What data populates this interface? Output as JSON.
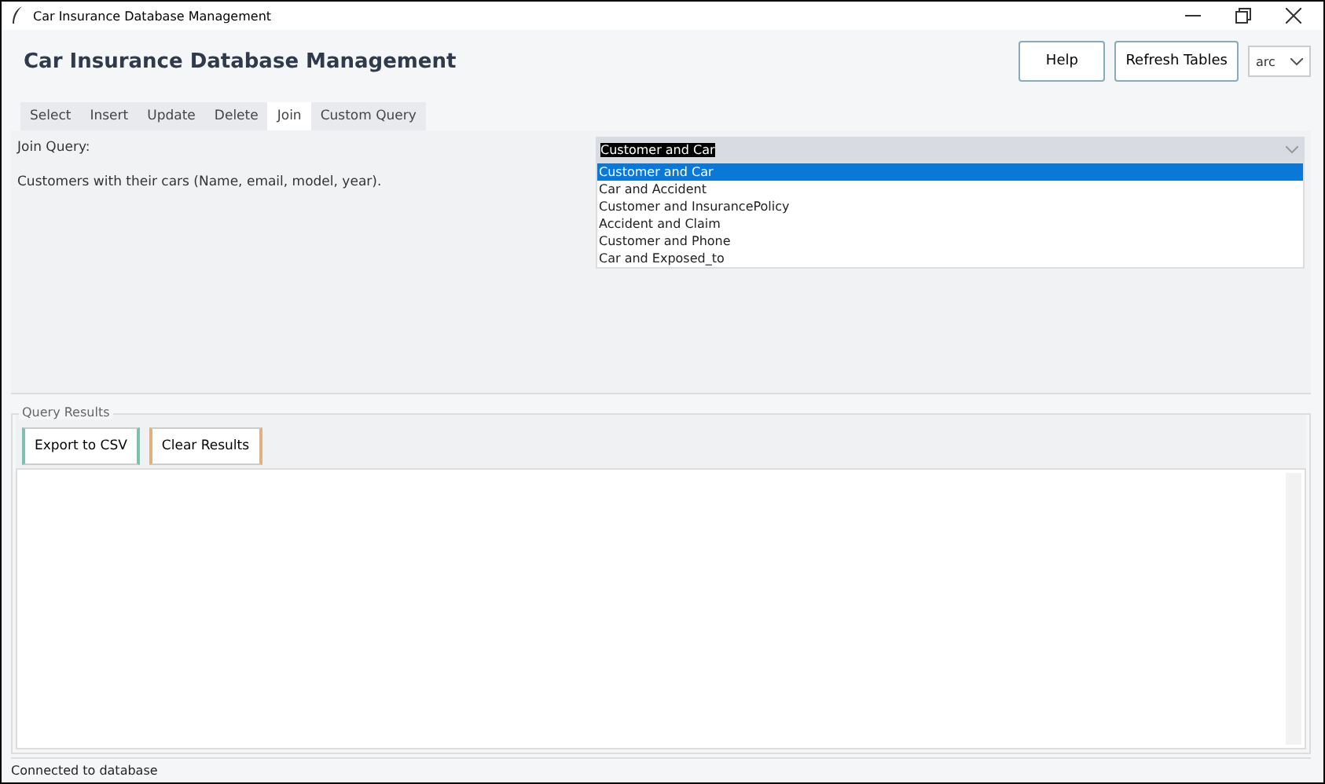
{
  "window": {
    "title": "Car Insurance Database Management"
  },
  "header": {
    "title": "Car Insurance Database Management",
    "buttons": [
      "Help",
      "Refresh Tables"
    ],
    "theme_select": {
      "value": "arc"
    }
  },
  "tabs": [
    {
      "label": "Select",
      "selected": false
    },
    {
      "label": "Insert",
      "selected": false
    },
    {
      "label": "Update",
      "selected": false
    },
    {
      "label": "Delete",
      "selected": false
    },
    {
      "label": "Join",
      "selected": true
    },
    {
      "label": "Custom Query",
      "selected": false
    }
  ],
  "join": {
    "label": "Join Query:",
    "description": "Customers with their cars (Name, email, model, year).",
    "combo_value": "Customer and Car",
    "options": [
      {
        "label": "Customer and Car",
        "selected": true
      },
      {
        "label": "Car and Accident",
        "selected": false
      },
      {
        "label": "Customer and InsurancePolicy",
        "selected": false
      },
      {
        "label": "Accident and Claim",
        "selected": false
      },
      {
        "label": "Customer and Phone",
        "selected": false
      },
      {
        "label": "Car and Exposed_to",
        "selected": false
      }
    ]
  },
  "results": {
    "title": "Query Results",
    "buttons": [
      "Export to CSV",
      "Clear Results"
    ]
  },
  "status_bar": "Connected to database"
}
